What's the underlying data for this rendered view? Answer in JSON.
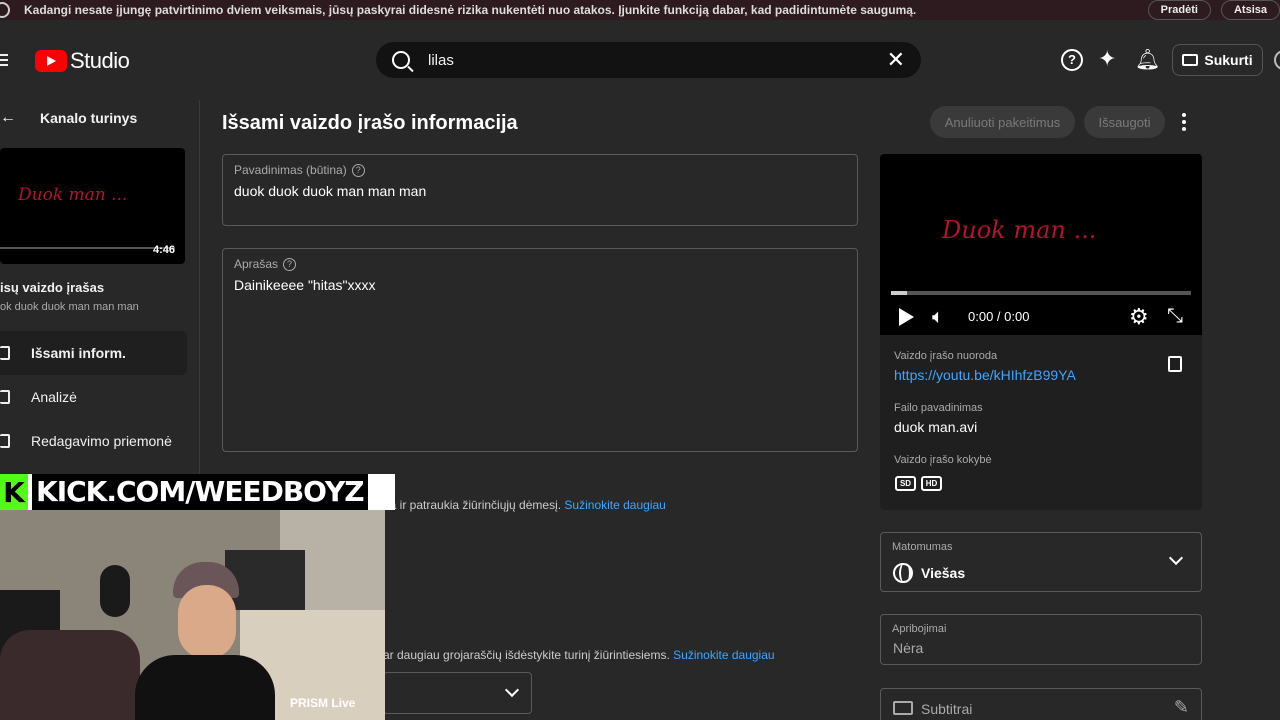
{
  "banner": {
    "text": "Kadangi nesate įjungę patvirtinimo dviem veiksmais, jūsų paskyrai didesnė rizika nukentėti nuo atakos. Įjunkite funkciją dabar, kad padidintumėte saugumą.",
    "start_label": "Pradėti",
    "dismiss_label": "Atsisa"
  },
  "header": {
    "logo_text": "Studio",
    "search_value": "lilas",
    "create_label": "Sukurti"
  },
  "sidebar": {
    "back_label": "Kanalo turinys",
    "thumb_title": "Duok man ...",
    "thumb_duration": "4:46",
    "video_label": "isų vaizdo įrašas",
    "video_sub": "ok duok duok man man man",
    "items": [
      {
        "label": "Išsami inform.",
        "active": true
      },
      {
        "label": "Analizė",
        "active": false
      },
      {
        "label": "Redagavimo priemonė",
        "active": false
      }
    ]
  },
  "main": {
    "title": "Išsami vaizdo įrašo informacija",
    "undo_label": "Anuliuoti pakeitimus",
    "save_label": "Išsaugoti",
    "title_field": {
      "label": "Pavadinimas (būtina)",
      "value": "duok duok duok man man man"
    },
    "description_field": {
      "label": "Aprašas",
      "value": "Dainikeeee \"hitas\"xxxx"
    },
    "hint1_text": "ria ir patraukia žiūrinčiųjų dėmesį.",
    "hint1_link": "Sužinokite daugiau",
    "hint2_text": "ar daugiau grojaraščių išdėstykite turinį žiūrintiesiems.",
    "hint2_link": "Sužinokite daugiau"
  },
  "right": {
    "player_title": "Duok man ...",
    "time": "0:00 / 0:00",
    "link_label": "Vaizdo įrašo nuoroda",
    "link_value": "https://youtu.be/kHIhfzB99YA",
    "file_label": "Failo pavadinimas",
    "file_value": "duok man.avi",
    "quality_label": "Vaizdo įrašo kokybė",
    "quality_badges": [
      "SD",
      "HD"
    ],
    "visibility_label": "Matomumas",
    "visibility_value": "Viešas",
    "restrictions_label": "Apribojimai",
    "restrictions_value": "Nėra",
    "subtitles_label": "Subtitrai"
  },
  "overlay": {
    "kick_k": "K",
    "kick_text": "KICK.COM/WEEDBOYZ",
    "prism_label": "PRISM Live"
  },
  "colors": {
    "accent_link": "#3ea6ff",
    "brand_red": "#ff0000",
    "kick_green": "#53fc18"
  }
}
